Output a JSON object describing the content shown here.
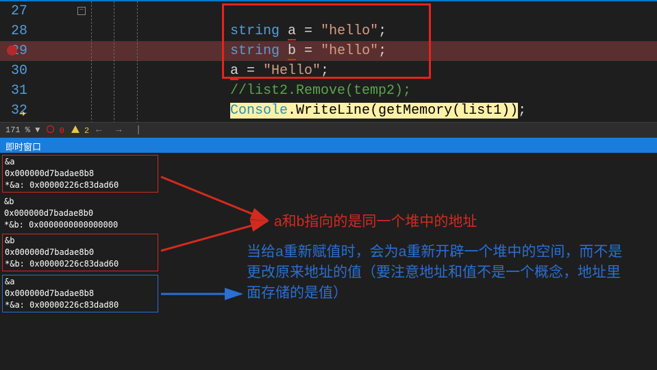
{
  "editor": {
    "lines": {
      "n27": "27",
      "n28": "28",
      "n29": "29",
      "n30": "30",
      "n31": "31",
      "n32": "32"
    },
    "code": {
      "l28_kw": "string",
      "l28_var": "a",
      "l28_eq": " = ",
      "l28_str": "\"hello\"",
      "l28_semi": ";",
      "l29_kw": "string",
      "l29_var": "b",
      "l29_eq": " = ",
      "l29_str": "\"hello\"",
      "l29_semi": ";",
      "l30_var": "a",
      "l30_eq": " = ",
      "l30_str": "\"Hello\"",
      "l30_semi": ";",
      "l31": "//list2.Remove(temp2);",
      "l32_type": "Console",
      "l32_dot": ".",
      "l32_m1": "WriteLine",
      "l32_p1": "(",
      "l32_m2": "getMemory",
      "l32_p2": "(",
      "l32_arg": "list1",
      "l32_p3": "))",
      "l32_semi": ";"
    }
  },
  "status": {
    "zoom": "171 %",
    "errors": "0",
    "warnings": "2",
    "zoom_combo": "▼"
  },
  "immediate": {
    "title": "即时窗口",
    "b1_l1": "&a",
    "b1_l2": "0x000000d7badae8b8",
    "b1_l3": "    *&a: 0x00000226c83dad60",
    "b2_l1": "&b",
    "b2_l2": "0x000000d7badae8b0",
    "b2_l3": "    *&b: 0x0000000000000000",
    "b3_l1": "&b",
    "b3_l2": "0x000000d7badae8b0",
    "b3_l3": "    *&b: 0x00000226c83dad60",
    "b4_l1": "&a",
    "b4_l2": "0x000000d7badae8b8",
    "b4_l3": "    *&a: 0x00000226c83dad80"
  },
  "annotations": {
    "red": "a和b指向的是同一个堆中的地址",
    "blue": "当给a重新赋值时，会为a重新开辟一个堆中的空间，而不是更改原来地址的值（要注意地址和值不是一个概念，地址里面存储的是值）"
  }
}
